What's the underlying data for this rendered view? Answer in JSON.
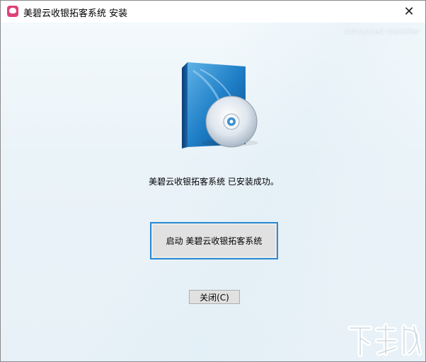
{
  "window": {
    "title": "美碧云收银拓客系统 安装",
    "close_glyph": "✕"
  },
  "brand": {
    "text": "Advanced Installer"
  },
  "main": {
    "message": "美碧云收银拓客系统 已安装成功。",
    "launch_button": "启动 美碧云收银拓客系统",
    "close_button": "关闭(C)"
  },
  "colors": {
    "accent": "#2a8ad4",
    "box_blue": "#1e78c2",
    "background": "#eaf3f8"
  }
}
